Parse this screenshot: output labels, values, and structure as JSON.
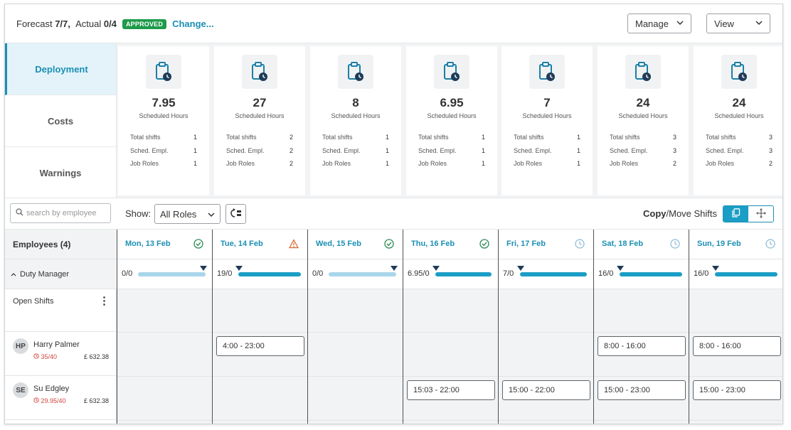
{
  "header": {
    "forecast_label": "Forecast",
    "forecast_value": "7/7,",
    "actual_label": "Actual",
    "actual_value": "0/4",
    "status_badge": "APPROVED",
    "change_link": "Change...",
    "manage_label": "Manage",
    "view_label": "View"
  },
  "side_tabs": [
    {
      "label": "Deployment",
      "active": true
    },
    {
      "label": "Costs",
      "active": false
    },
    {
      "label": "Warnings",
      "active": false
    }
  ],
  "cards": [
    {
      "hours": "7.95",
      "hours_label": "Scheduled Hours",
      "total_shifts": "1",
      "sched_empl": "1",
      "job_roles": "1"
    },
    {
      "hours": "27",
      "hours_label": "Scheduled Hours",
      "total_shifts": "2",
      "sched_empl": "2",
      "job_roles": "2"
    },
    {
      "hours": "8",
      "hours_label": "Scheduled Hours",
      "total_shifts": "1",
      "sched_empl": "1",
      "job_roles": "1"
    },
    {
      "hours": "6.95",
      "hours_label": "Scheduled Hours",
      "total_shifts": "1",
      "sched_empl": "1",
      "job_roles": "1"
    },
    {
      "hours": "7",
      "hours_label": "Scheduled Hours",
      "total_shifts": "1",
      "sched_empl": "1",
      "job_roles": "1"
    },
    {
      "hours": "24",
      "hours_label": "Scheduled Hours",
      "total_shifts": "3",
      "sched_empl": "3",
      "job_roles": "2"
    },
    {
      "hours": "24",
      "hours_label": "Scheduled Hours",
      "total_shifts": "3",
      "sched_empl": "3",
      "job_roles": "2"
    }
  ],
  "card_row_labels": {
    "total_shifts": "Total shifts",
    "sched_empl": "Sched. Empl.",
    "job_roles": "Job Roles"
  },
  "toolbar": {
    "search_placeholder": "search by employee",
    "show_label": "Show:",
    "roles_value": "All Roles",
    "copy_label": "Copy",
    "move_label": "/Move Shifts"
  },
  "grid": {
    "employees_header": "Employees (4)",
    "role_header": "Duty Manager",
    "open_shifts_label": "Open Shifts",
    "employees": [
      {
        "initials": "HP",
        "name": "Harry Palmer",
        "hours": "35/40",
        "cost": "£ 632.38"
      },
      {
        "initials": "SE",
        "name": "Su Edgley",
        "hours": "29.95/40",
        "cost": "£ 632.38"
      }
    ],
    "days": [
      {
        "label": "Mon, 13 Feb",
        "status": "ok",
        "role_value": "0/0",
        "bar_style": "light",
        "shifts": [
          "",
          ""
        ]
      },
      {
        "label": "Tue, 14 Feb",
        "status": "warning",
        "role_value": "19/0",
        "bar_style": "dark",
        "shifts": [
          "4:00 - 23:00",
          ""
        ]
      },
      {
        "label": "Wed, 15 Feb",
        "status": "ok",
        "role_value": "0/0",
        "bar_style": "light",
        "shifts": [
          "",
          ""
        ]
      },
      {
        "label": "Thu, 16 Feb",
        "status": "ok",
        "role_value": "6.95/0",
        "bar_style": "dark",
        "shifts": [
          "",
          "15:03 - 22:00"
        ]
      },
      {
        "label": "Fri, 17 Feb",
        "status": "pending",
        "role_value": "7/0",
        "bar_style": "dark",
        "shifts": [
          "",
          "15:00 - 22:00"
        ]
      },
      {
        "label": "Sat, 18 Feb",
        "status": "pending",
        "role_value": "16/0",
        "bar_style": "dark",
        "shifts": [
          "8:00 - 16:00",
          "15:00 - 23:00"
        ]
      },
      {
        "label": "Sun, 19 Feb",
        "status": "pending",
        "role_value": "16/0",
        "bar_style": "dark",
        "shifts": [
          "8:00 - 16:00",
          "15:00 - 23:00"
        ]
      }
    ]
  },
  "colors": {
    "accent": "#1b8fb4",
    "approved": "#1e9a4a",
    "warning": "#d9622b",
    "ok": "#2e8b57",
    "pending": "#8ab9d4",
    "over_hours": "#d0443b"
  }
}
